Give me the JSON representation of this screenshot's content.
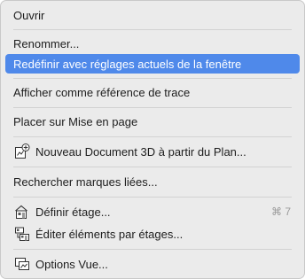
{
  "menu": {
    "items": [
      {
        "label": "Ouvrir"
      },
      {
        "label": "Renommer..."
      },
      {
        "label": "Redéfinir avec réglages actuels de la fenêtre",
        "selected": true
      },
      {
        "label": "Afficher comme référence de trace"
      },
      {
        "label": "Placer sur Mise en page"
      },
      {
        "label": "Nouveau Document 3D à partir du Plan...",
        "icon": "document-3d-add-icon"
      },
      {
        "label": "Rechercher marques liées..."
      },
      {
        "label": "Définir étage...",
        "icon": "define-story-icon",
        "shortcut": "⌘ 7"
      },
      {
        "label": "Éditer éléments par étages...",
        "icon": "edit-stories-icon"
      },
      {
        "label": "Options Vue...",
        "icon": "view-options-icon"
      }
    ]
  }
}
